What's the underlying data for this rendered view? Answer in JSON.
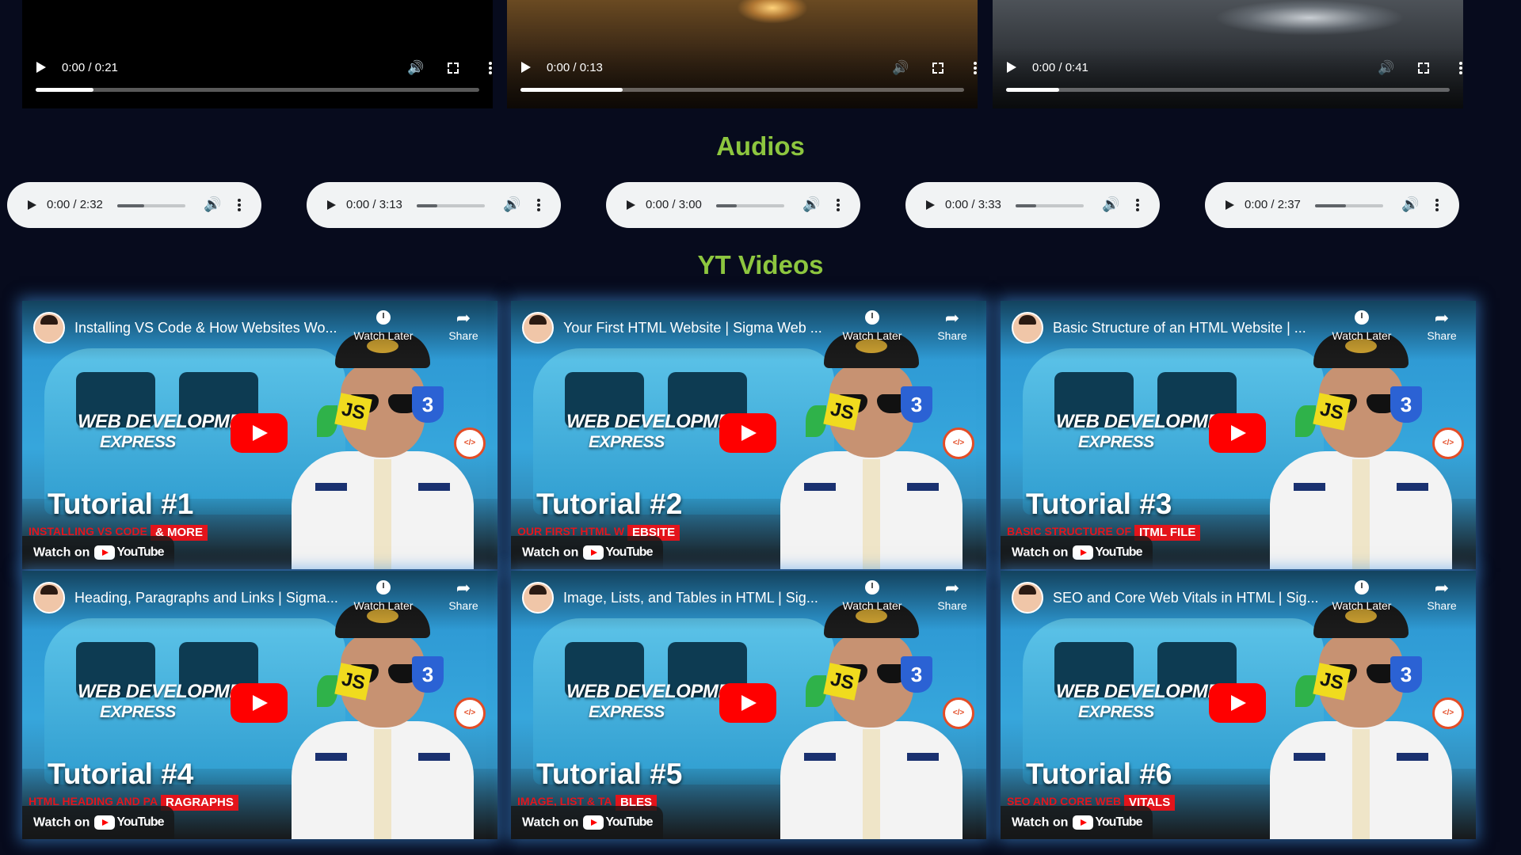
{
  "videos": [
    {
      "time": "0:00 / 0:21",
      "progress": 0.13
    },
    {
      "time": "0:00 / 0:13",
      "progress": 0.23
    },
    {
      "time": "0:00 / 0:41",
      "progress": 0.12
    }
  ],
  "audios_heading": "Audios",
  "audios": [
    {
      "time": "0:00 / 2:32",
      "volume": 0.4
    },
    {
      "time": "0:00 / 3:13",
      "volume": 0.3
    },
    {
      "time": "0:00 / 3:00",
      "volume": 0.3
    },
    {
      "time": "0:00 / 3:33",
      "volume": 0.3
    },
    {
      "time": "0:00 / 2:37",
      "volume": 0.45
    }
  ],
  "yt_heading": "YT Videos",
  "yt_labels": {
    "watch_later": "Watch Later",
    "share": "Share",
    "watch_on": "Watch on",
    "youtube": "YouTube"
  },
  "yt_videos": [
    {
      "title": "Installing VS Code & How Websites Wo...",
      "tutorial": "Tutorial #1",
      "thumb_text": "WEB DEVELOPMENT",
      "thumb_sub": "EXPRESS",
      "subtitle": "INSTALLING VS CODE",
      "subtitle_red": "& MORE"
    },
    {
      "title": "Your First HTML Website | Sigma Web ...",
      "tutorial": "Tutorial #2",
      "thumb_text": "WEB DEVELOPMENT",
      "thumb_sub": "EXPRESS",
      "subtitle": "OUR FIRST HTML W",
      "subtitle_red": "EBSITE"
    },
    {
      "title": "Basic Structure of an HTML Website | ...",
      "tutorial": "Tutorial #3",
      "thumb_text": "WEB DEVELOPMENT",
      "thumb_sub": "EXPRESS",
      "subtitle": "BASIC STRUCTURE OF",
      "subtitle_red": "ITML FILE"
    },
    {
      "title": "Heading, Paragraphs and Links | Sigma...",
      "tutorial": "Tutorial #4",
      "thumb_text": "WEB DEVELOPMENT",
      "thumb_sub": "EXPRESS",
      "subtitle": "HTML HEADING AND PA",
      "subtitle_red": "RAGRAPHS"
    },
    {
      "title": "Image, Lists, and Tables in HTML | Sig...",
      "tutorial": "Tutorial #5",
      "thumb_text": "WEB DEVELOPMENT",
      "thumb_sub": "EXPRESS",
      "subtitle": "IMAGE, LIST & TA",
      "subtitle_red": "BLES"
    },
    {
      "title": "SEO and Core Web Vitals in HTML | Sig...",
      "tutorial": "Tutorial #6",
      "thumb_text": "WEB DEVELOPMENT",
      "thumb_sub": "EXPRESS",
      "subtitle": "SEO AND CORE WEB",
      "subtitle_red": "VITALS"
    }
  ],
  "icons": {
    "play": "play-icon",
    "volume": "volume-icon",
    "fullscreen": "fullscreen-icon",
    "more": "more-vert-icon",
    "clock": "clock-icon",
    "share": "share-icon",
    "youtube": "youtube-logo"
  },
  "colors": {
    "background": "#070b1d",
    "heading": "#8dc63f",
    "audio_bg": "#f1f3f4",
    "yt_red": "#ff0000",
    "glow": "#4496e6"
  }
}
